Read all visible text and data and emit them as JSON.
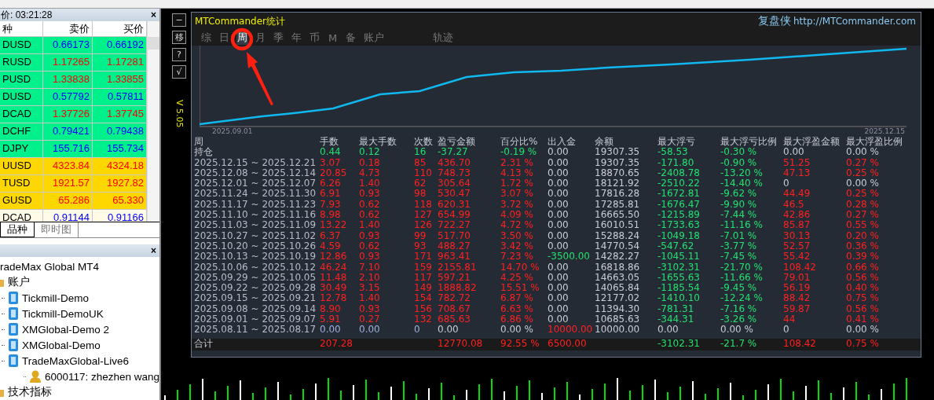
{
  "market_watch": {
    "title": "价: 03:21:28",
    "close": "×",
    "columns": [
      "种",
      "卖价",
      "买价"
    ],
    "rows": [
      {
        "symbol": "DUSD",
        "bid": "0.66173",
        "ask": "0.66192",
        "kind": "forex",
        "color": "#0000ff"
      },
      {
        "symbol": "RUSD",
        "bid": "1.17265",
        "ask": "1.17281",
        "kind": "forex",
        "color": "#ff0000"
      },
      {
        "symbol": "PUSD",
        "bid": "1.33838",
        "ask": "1.33855",
        "kind": "forex",
        "color": "#ff0000"
      },
      {
        "symbol": "DUSD",
        "bid": "0.57792",
        "ask": "0.57811",
        "kind": "forex",
        "color": "#0000ff"
      },
      {
        "symbol": "DCAD",
        "bid": "1.37726",
        "ask": "1.37745",
        "kind": "forex",
        "color": "#ff0000"
      },
      {
        "symbol": "DCHF",
        "bid": "0.79421",
        "ask": "0.79438",
        "kind": "forex",
        "color": "#0000ff"
      },
      {
        "symbol": "DJPY",
        "bid": "155.716",
        "ask": "155.734",
        "kind": "forex",
        "color": "#0000ff"
      },
      {
        "symbol": "UUSD",
        "bid": "4323.84",
        "ask": "4324.18",
        "kind": "metal",
        "color": "#ff0000"
      },
      {
        "symbol": "TUSD",
        "bid": "1921.57",
        "ask": "1927.82",
        "kind": "metal",
        "color": "#ff0000"
      },
      {
        "symbol": "GUSD",
        "bid": "65.286",
        "ask": "65.330",
        "kind": "metal",
        "color": "#ff0000"
      },
      {
        "symbol": "DCAD",
        "bid": "0.91144",
        "ask": "0.91166",
        "kind": "other",
        "color": "#0000ff"
      }
    ],
    "tabs": [
      {
        "label": "品种",
        "selected": true
      },
      {
        "label": "即时图",
        "selected": false
      }
    ]
  },
  "navigator": {
    "close": "×",
    "tree": {
      "label": "radeMax Global MT4",
      "children": [
        {
          "label": "账户",
          "kind": "folder",
          "children": [
            {
              "label": "Tickmill-Demo",
              "kind": "server"
            },
            {
              "label": "Tickmill-DemoUK",
              "kind": "server"
            },
            {
              "label": "XMGlobal-Demo 2",
              "kind": "server"
            },
            {
              "label": "XMGlobal-Demo",
              "kind": "server"
            },
            {
              "label": "TradeMaxGlobal-Live6",
              "kind": "server",
              "children": [
                {
                  "label": "6000117: zhezhen wang",
                  "kind": "account"
                }
              ]
            }
          ]
        },
        {
          "label": "技术指标",
          "kind": "folder"
        }
      ]
    }
  },
  "side_buttons": [
    "−",
    "移",
    "?",
    "√"
  ],
  "version": "V 5.05",
  "panel": {
    "title": "MTCommander统计",
    "brand": "复盘侠",
    "link": "http://MTCommander.com",
    "tabs": [
      {
        "label": "综",
        "selected": false
      },
      {
        "label": "日",
        "selected": false
      },
      {
        "label": "周",
        "selected": true
      },
      {
        "label": "月",
        "selected": false
      },
      {
        "label": "季",
        "selected": false
      },
      {
        "label": "年",
        "selected": false
      },
      {
        "label": "币",
        "selected": false
      },
      {
        "label": "M",
        "selected": false
      },
      {
        "label": "备",
        "selected": false
      },
      {
        "label": "账户",
        "selected": false
      }
    ],
    "trail_tab": {
      "label": "轨迹",
      "selected": false
    },
    "chart": {
      "start_label": "2025.09.01",
      "end_label": "2025.12.15"
    },
    "table": {
      "columns": [
        "周",
        "手数",
        "最大手数",
        "次数",
        "盈亏金额",
        "百分比%",
        "出入金",
        "余额",
        "最大浮亏",
        "最大浮亏比例",
        "最大浮盈金额",
        "最大浮盈比例"
      ],
      "rows": [
        {
          "kind": "open",
          "cells": [
            {
              "text": "持仓"
            },
            {
              "text": "0.44",
              "color": "#22e070"
            },
            {
              "text": "0.12",
              "color": "#22e070"
            },
            {
              "text": "16",
              "color": "#22e070"
            },
            {
              "text": "-37.27",
              "color": "#22e070"
            },
            {
              "text": "-0.19 %",
              "color": "#22e070"
            },
            {
              "text": "0.00",
              "color": "#c8ccd4"
            },
            {
              "text": "19307.35",
              "color": "#c8ccd4"
            },
            {
              "text": "-58.53",
              "color": "#22e070"
            },
            {
              "text": "-0.30 %",
              "color": "#22e070"
            },
            {
              "text": "0.00",
              "color": "#c8ccd4"
            },
            {
              "text": "0.00 %",
              "color": "#c8ccd4"
            }
          ]
        },
        {
          "kind": "week",
          "cells": [
            {
              "text": "2025.12.15 ~ 2025.12.21",
              "color": "#b4bccc"
            },
            {
              "text": "3.07",
              "color": "#ff2020"
            },
            {
              "text": "0.18",
              "color": "#ff2020"
            },
            {
              "text": "85",
              "color": "#ff2020"
            },
            {
              "text": "436.70",
              "color": "#ff2020"
            },
            {
              "text": "2.31 %",
              "color": "#ff2020"
            },
            {
              "text": "0.00",
              "color": "#c8ccd4"
            },
            {
              "text": "19307.35",
              "color": "#c8ccd4"
            },
            {
              "text": "-171.80",
              "color": "#22e070"
            },
            {
              "text": "-0.90 %",
              "color": "#22e070"
            },
            {
              "text": "51.25",
              "color": "#ff2020"
            },
            {
              "text": "0.27 %",
              "color": "#ff2020"
            }
          ]
        },
        {
          "kind": "week",
          "cells": [
            {
              "text": "2025.12.08 ~ 2025.12.14",
              "color": "#b4bccc"
            },
            {
              "text": "20.85",
              "color": "#ff2020"
            },
            {
              "text": "4.73",
              "color": "#ff2020"
            },
            {
              "text": "110",
              "color": "#ff2020"
            },
            {
              "text": "748.73",
              "color": "#ff2020"
            },
            {
              "text": "4.13 %",
              "color": "#ff2020"
            },
            {
              "text": "0.00",
              "color": "#c8ccd4"
            },
            {
              "text": "18870.65",
              "color": "#c8ccd4"
            },
            {
              "text": "-2408.78",
              "color": "#22e070"
            },
            {
              "text": "-13.20 %",
              "color": "#22e070"
            },
            {
              "text": "47.13",
              "color": "#ff2020"
            },
            {
              "text": "0.25 %",
              "color": "#ff2020"
            }
          ]
        },
        {
          "kind": "week",
          "cells": [
            {
              "text": "2025.12.01 ~ 2025.12.07",
              "color": "#b4bccc"
            },
            {
              "text": "6.26",
              "color": "#ff2020"
            },
            {
              "text": "1.40",
              "color": "#ff2020"
            },
            {
              "text": "62",
              "color": "#ff2020"
            },
            {
              "text": "305.64",
              "color": "#ff2020"
            },
            {
              "text": "1.72 %",
              "color": "#ff2020"
            },
            {
              "text": "0.00",
              "color": "#c8ccd4"
            },
            {
              "text": "18121.92",
              "color": "#c8ccd4"
            },
            {
              "text": "-2510.22",
              "color": "#22e070"
            },
            {
              "text": "-14.40 %",
              "color": "#22e070"
            },
            {
              "text": "0",
              "color": "#c8ccd4"
            },
            {
              "text": "0.00 %",
              "color": "#c8ccd4"
            }
          ]
        },
        {
          "kind": "week",
          "cells": [
            {
              "text": "2025.11.24 ~ 2025.11.30",
              "color": "#b4bccc"
            },
            {
              "text": "6.91",
              "color": "#ff2020"
            },
            {
              "text": "0.93",
              "color": "#ff2020"
            },
            {
              "text": "98",
              "color": "#ff2020"
            },
            {
              "text": "530.47",
              "color": "#ff2020"
            },
            {
              "text": "3.07 %",
              "color": "#ff2020"
            },
            {
              "text": "0.00",
              "color": "#c8ccd4"
            },
            {
              "text": "17816.28",
              "color": "#c8ccd4"
            },
            {
              "text": "-1672.81",
              "color": "#22e070"
            },
            {
              "text": "-9.62 %",
              "color": "#22e070"
            },
            {
              "text": "44.49",
              "color": "#ff2020"
            },
            {
              "text": "0.25 %",
              "color": "#ff2020"
            }
          ]
        },
        {
          "kind": "week",
          "cells": [
            {
              "text": "2025.11.17 ~ 2025.11.23",
              "color": "#b4bccc"
            },
            {
              "text": "7.93",
              "color": "#ff2020"
            },
            {
              "text": "0.62",
              "color": "#ff2020"
            },
            {
              "text": "118",
              "color": "#ff2020"
            },
            {
              "text": "620.31",
              "color": "#ff2020"
            },
            {
              "text": "3.72 %",
              "color": "#ff2020"
            },
            {
              "text": "0.00",
              "color": "#c8ccd4"
            },
            {
              "text": "17285.81",
              "color": "#c8ccd4"
            },
            {
              "text": "-1676.47",
              "color": "#22e070"
            },
            {
              "text": "-9.90 %",
              "color": "#22e070"
            },
            {
              "text": "46.5",
              "color": "#ff2020"
            },
            {
              "text": "0.28 %",
              "color": "#ff2020"
            }
          ]
        },
        {
          "kind": "week",
          "cells": [
            {
              "text": "2025.11.10 ~ 2025.11.16",
              "color": "#b4bccc"
            },
            {
              "text": "8.98",
              "color": "#ff2020"
            },
            {
              "text": "0.62",
              "color": "#ff2020"
            },
            {
              "text": "127",
              "color": "#ff2020"
            },
            {
              "text": "654.99",
              "color": "#ff2020"
            },
            {
              "text": "4.09 %",
              "color": "#ff2020"
            },
            {
              "text": "0.00",
              "color": "#c8ccd4"
            },
            {
              "text": "16665.50",
              "color": "#c8ccd4"
            },
            {
              "text": "-1215.89",
              "color": "#22e070"
            },
            {
              "text": "-7.44 %",
              "color": "#22e070"
            },
            {
              "text": "42.86",
              "color": "#ff2020"
            },
            {
              "text": "0.27 %",
              "color": "#ff2020"
            }
          ]
        },
        {
          "kind": "week",
          "cells": [
            {
              "text": "2025.11.03 ~ 2025.11.09",
              "color": "#b4bccc"
            },
            {
              "text": "13.22",
              "color": "#ff2020"
            },
            {
              "text": "1.40",
              "color": "#ff2020"
            },
            {
              "text": "126",
              "color": "#ff2020"
            },
            {
              "text": "722.27",
              "color": "#ff2020"
            },
            {
              "text": "4.72 %",
              "color": "#ff2020"
            },
            {
              "text": "0.00",
              "color": "#c8ccd4"
            },
            {
              "text": "16010.51",
              "color": "#c8ccd4"
            },
            {
              "text": "-1733.63",
              "color": "#22e070"
            },
            {
              "text": "-11.16 %",
              "color": "#22e070"
            },
            {
              "text": "85.87",
              "color": "#ff2020"
            },
            {
              "text": "0.55 %",
              "color": "#ff2020"
            }
          ]
        },
        {
          "kind": "week",
          "cells": [
            {
              "text": "2025.10.27 ~ 2025.11.02",
              "color": "#b4bccc"
            },
            {
              "text": "6.37",
              "color": "#ff2020"
            },
            {
              "text": "0.93",
              "color": "#ff2020"
            },
            {
              "text": "99",
              "color": "#ff2020"
            },
            {
              "text": "517.70",
              "color": "#ff2020"
            },
            {
              "text": "3.50 %",
              "color": "#ff2020"
            },
            {
              "text": "0.00",
              "color": "#c8ccd4"
            },
            {
              "text": "15288.24",
              "color": "#c8ccd4"
            },
            {
              "text": "-1049.18",
              "color": "#22e070"
            },
            {
              "text": "-7.01 %",
              "color": "#22e070"
            },
            {
              "text": "30.13",
              "color": "#ff2020"
            },
            {
              "text": "0.20 %",
              "color": "#ff2020"
            }
          ]
        },
        {
          "kind": "week",
          "cells": [
            {
              "text": "2025.10.20 ~ 2025.10.26",
              "color": "#b4bccc"
            },
            {
              "text": "4.59",
              "color": "#ff2020"
            },
            {
              "text": "0.62",
              "color": "#ff2020"
            },
            {
              "text": "93",
              "color": "#ff2020"
            },
            {
              "text": "488.27",
              "color": "#ff2020"
            },
            {
              "text": "3.42 %",
              "color": "#ff2020"
            },
            {
              "text": "0.00",
              "color": "#c8ccd4"
            },
            {
              "text": "14770.54",
              "color": "#c8ccd4"
            },
            {
              "text": "-547.62",
              "color": "#22e070"
            },
            {
              "text": "-3.77 %",
              "color": "#22e070"
            },
            {
              "text": "52.57",
              "color": "#ff2020"
            },
            {
              "text": "0.36 %",
              "color": "#ff2020"
            }
          ]
        },
        {
          "kind": "week",
          "cells": [
            {
              "text": "2025.10.13 ~ 2025.10.19",
              "color": "#b4bccc"
            },
            {
              "text": "12.86",
              "color": "#ff2020"
            },
            {
              "text": "0.93",
              "color": "#ff2020"
            },
            {
              "text": "171",
              "color": "#ff2020"
            },
            {
              "text": "963.41",
              "color": "#ff2020"
            },
            {
              "text": "7.23 %",
              "color": "#ff2020"
            },
            {
              "text": "-3500.00",
              "color": "#22e070"
            },
            {
              "text": "14282.27",
              "color": "#c8ccd4"
            },
            {
              "text": "-1045.11",
              "color": "#22e070"
            },
            {
              "text": "-7.45 %",
              "color": "#22e070"
            },
            {
              "text": "55.42",
              "color": "#ff2020"
            },
            {
              "text": "0.39 %",
              "color": "#ff2020"
            }
          ]
        },
        {
          "kind": "week",
          "cells": [
            {
              "text": "2025.10.06 ~ 2025.10.12",
              "color": "#b4bccc"
            },
            {
              "text": "46.24",
              "color": "#ff2020"
            },
            {
              "text": "7.10",
              "color": "#ff2020"
            },
            {
              "text": "159",
              "color": "#ff2020"
            },
            {
              "text": "2155.81",
              "color": "#ff2020"
            },
            {
              "text": "14.70 %",
              "color": "#ff2020"
            },
            {
              "text": "0.00",
              "color": "#c8ccd4"
            },
            {
              "text": "16818.86",
              "color": "#c8ccd4"
            },
            {
              "text": "-3102.31",
              "color": "#22e070"
            },
            {
              "text": "-21.70 %",
              "color": "#22e070"
            },
            {
              "text": "108.42",
              "color": "#ff2020"
            },
            {
              "text": "0.66 %",
              "color": "#ff2020"
            }
          ]
        },
        {
          "kind": "week",
          "cells": [
            {
              "text": "2025.09.29 ~ 2025.10.05",
              "color": "#b4bccc"
            },
            {
              "text": "11.48",
              "color": "#ff2020"
            },
            {
              "text": "2.10",
              "color": "#ff2020"
            },
            {
              "text": "117",
              "color": "#ff2020"
            },
            {
              "text": "597.21",
              "color": "#ff2020"
            },
            {
              "text": "4.25 %",
              "color": "#ff2020"
            },
            {
              "text": "0.00",
              "color": "#c8ccd4"
            },
            {
              "text": "14663.05",
              "color": "#c8ccd4"
            },
            {
              "text": "-1655.63",
              "color": "#22e070"
            },
            {
              "text": "-11.66 %",
              "color": "#22e070"
            },
            {
              "text": "79.01",
              "color": "#ff2020"
            },
            {
              "text": "0.56 %",
              "color": "#ff2020"
            }
          ]
        },
        {
          "kind": "week",
          "cells": [
            {
              "text": "2025.09.22 ~ 2025.09.28",
              "color": "#b4bccc"
            },
            {
              "text": "30.49",
              "color": "#ff2020"
            },
            {
              "text": "3.15",
              "color": "#ff2020"
            },
            {
              "text": "149",
              "color": "#ff2020"
            },
            {
              "text": "1888.82",
              "color": "#ff2020"
            },
            {
              "text": "15.51 %",
              "color": "#ff2020"
            },
            {
              "text": "0.00",
              "color": "#c8ccd4"
            },
            {
              "text": "14065.84",
              "color": "#c8ccd4"
            },
            {
              "text": "-1185.54",
              "color": "#22e070"
            },
            {
              "text": "-9.45 %",
              "color": "#22e070"
            },
            {
              "text": "56.19",
              "color": "#ff2020"
            },
            {
              "text": "0.40 %",
              "color": "#ff2020"
            }
          ]
        },
        {
          "kind": "week",
          "cells": [
            {
              "text": "2025.09.15 ~ 2025.09.21",
              "color": "#b4bccc"
            },
            {
              "text": "12.78",
              "color": "#ff2020"
            },
            {
              "text": "1.40",
              "color": "#ff2020"
            },
            {
              "text": "154",
              "color": "#ff2020"
            },
            {
              "text": "782.72",
              "color": "#ff2020"
            },
            {
              "text": "6.87 %",
              "color": "#ff2020"
            },
            {
              "text": "0.00",
              "color": "#c8ccd4"
            },
            {
              "text": "12177.02",
              "color": "#c8ccd4"
            },
            {
              "text": "-1410.10",
              "color": "#22e070"
            },
            {
              "text": "-12.24 %",
              "color": "#22e070"
            },
            {
              "text": "88.42",
              "color": "#ff2020"
            },
            {
              "text": "0.75 %",
              "color": "#ff2020"
            }
          ]
        },
        {
          "kind": "week",
          "cells": [
            {
              "text": "2025.09.08 ~ 2025.09.14",
              "color": "#b4bccc"
            },
            {
              "text": "8.90",
              "color": "#ff2020"
            },
            {
              "text": "0.93",
              "color": "#ff2020"
            },
            {
              "text": "156",
              "color": "#ff2020"
            },
            {
              "text": "708.67",
              "color": "#ff2020"
            },
            {
              "text": "6.63 %",
              "color": "#ff2020"
            },
            {
              "text": "0.00",
              "color": "#c8ccd4"
            },
            {
              "text": "11394.30",
              "color": "#c8ccd4"
            },
            {
              "text": "-781.31",
              "color": "#22e070"
            },
            {
              "text": "-7.16 %",
              "color": "#22e070"
            },
            {
              "text": "59.87",
              "color": "#ff2020"
            },
            {
              "text": "0.56 %",
              "color": "#ff2020"
            }
          ]
        },
        {
          "kind": "week",
          "cells": [
            {
              "text": "2025.09.01 ~ 2025.09.07",
              "color": "#b4bccc"
            },
            {
              "text": "5.91",
              "color": "#ff2020"
            },
            {
              "text": "0.27",
              "color": "#ff2020"
            },
            {
              "text": "132",
              "color": "#ff2020"
            },
            {
              "text": "685.63",
              "color": "#ff2020"
            },
            {
              "text": "6.86 %",
              "color": "#ff2020"
            },
            {
              "text": "0.00",
              "color": "#c8ccd4"
            },
            {
              "text": "10685.63",
              "color": "#c8ccd4"
            },
            {
              "text": "-344.31",
              "color": "#22e070"
            },
            {
              "text": "-3.26 %",
              "color": "#22e070"
            },
            {
              "text": "44",
              "color": "#ff2020"
            },
            {
              "text": "0.41 %",
              "color": "#ff2020"
            }
          ]
        },
        {
          "kind": "week",
          "cells": [
            {
              "text": "2025.08.11 ~ 2025.08.17",
              "color": "#b4bccc"
            },
            {
              "text": "0.00",
              "color": "#9db0dc"
            },
            {
              "text": "0.00",
              "color": "#9db0dc"
            },
            {
              "text": "0",
              "color": "#9db0dc"
            },
            {
              "text": "0.00",
              "color": "#c8ccd4"
            },
            {
              "text": "0.00 %",
              "color": "#c8ccd4"
            },
            {
              "text": "10000.00",
              "color": "#ff2020"
            },
            {
              "text": "10000.00",
              "color": "#c8ccd4"
            },
            {
              "text": "0.00",
              "color": "#c8ccd4"
            },
            {
              "text": "0.00 %",
              "color": "#c8ccd4"
            },
            {
              "text": "0",
              "color": "#c8ccd4"
            },
            {
              "text": "0.00 %",
              "color": "#c8ccd4"
            }
          ]
        },
        {
          "kind": "total",
          "cells": [
            {
              "text": "合计"
            },
            {
              "text": "207.28",
              "color": "#ff2020"
            },
            {
              "text": ""
            },
            {
              "text": ""
            },
            {
              "text": "12770.08",
              "color": "#ff2020"
            },
            {
              "text": "92.55 %",
              "color": "#ff2020"
            },
            {
              "text": "6500.00",
              "color": "#ff2020"
            },
            {
              "text": ""
            },
            {
              "text": "-3102.31",
              "color": "#22e070"
            },
            {
              "text": "-21.7 %",
              "color": "#22e070"
            },
            {
              "text": "108.42",
              "color": "#ff2020"
            },
            {
              "text": "0.75 %",
              "color": "#ff2020"
            }
          ]
        }
      ]
    }
  }
}
